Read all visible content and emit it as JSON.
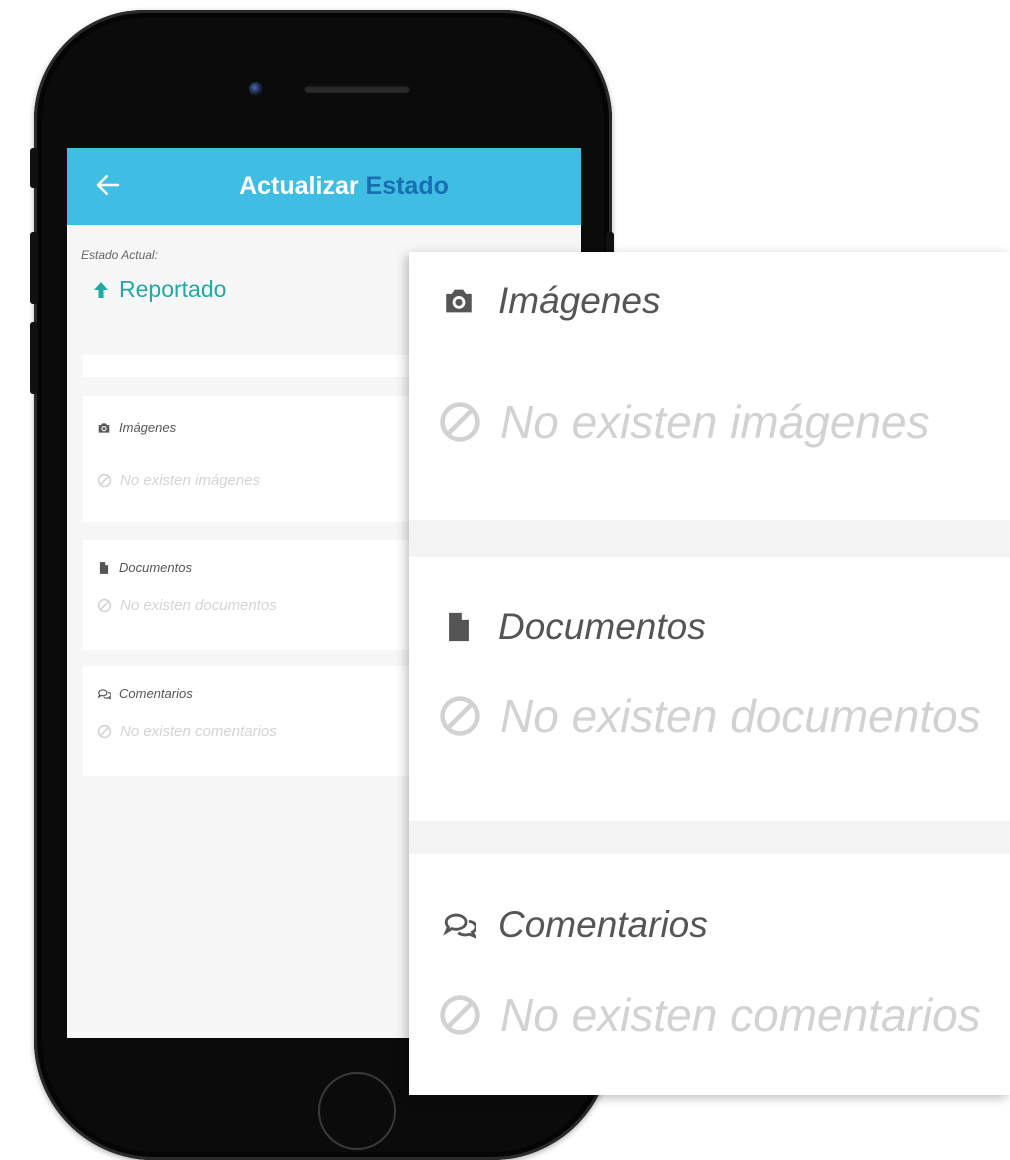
{
  "appbar": {
    "title_main": "Actualizar",
    "title_accent": "Estado"
  },
  "estado": {
    "label": "Estado Actual:",
    "value": "Reportado"
  },
  "sections": {
    "images": {
      "title": "Imágenes",
      "empty": "No existen imágenes"
    },
    "documents": {
      "title": "Documentos",
      "empty": "No existen documentos"
    },
    "comments": {
      "title": "Comentarios",
      "empty": "No existen comentarios"
    }
  },
  "colors": {
    "appbar": "#3fbde2",
    "accent": "#1a6fb4",
    "status": "#22a9a3"
  },
  "icons": [
    "back-arrow-icon",
    "arrow-up-icon",
    "camera-icon",
    "file-icon",
    "comments-icon",
    "ban-icon"
  ]
}
